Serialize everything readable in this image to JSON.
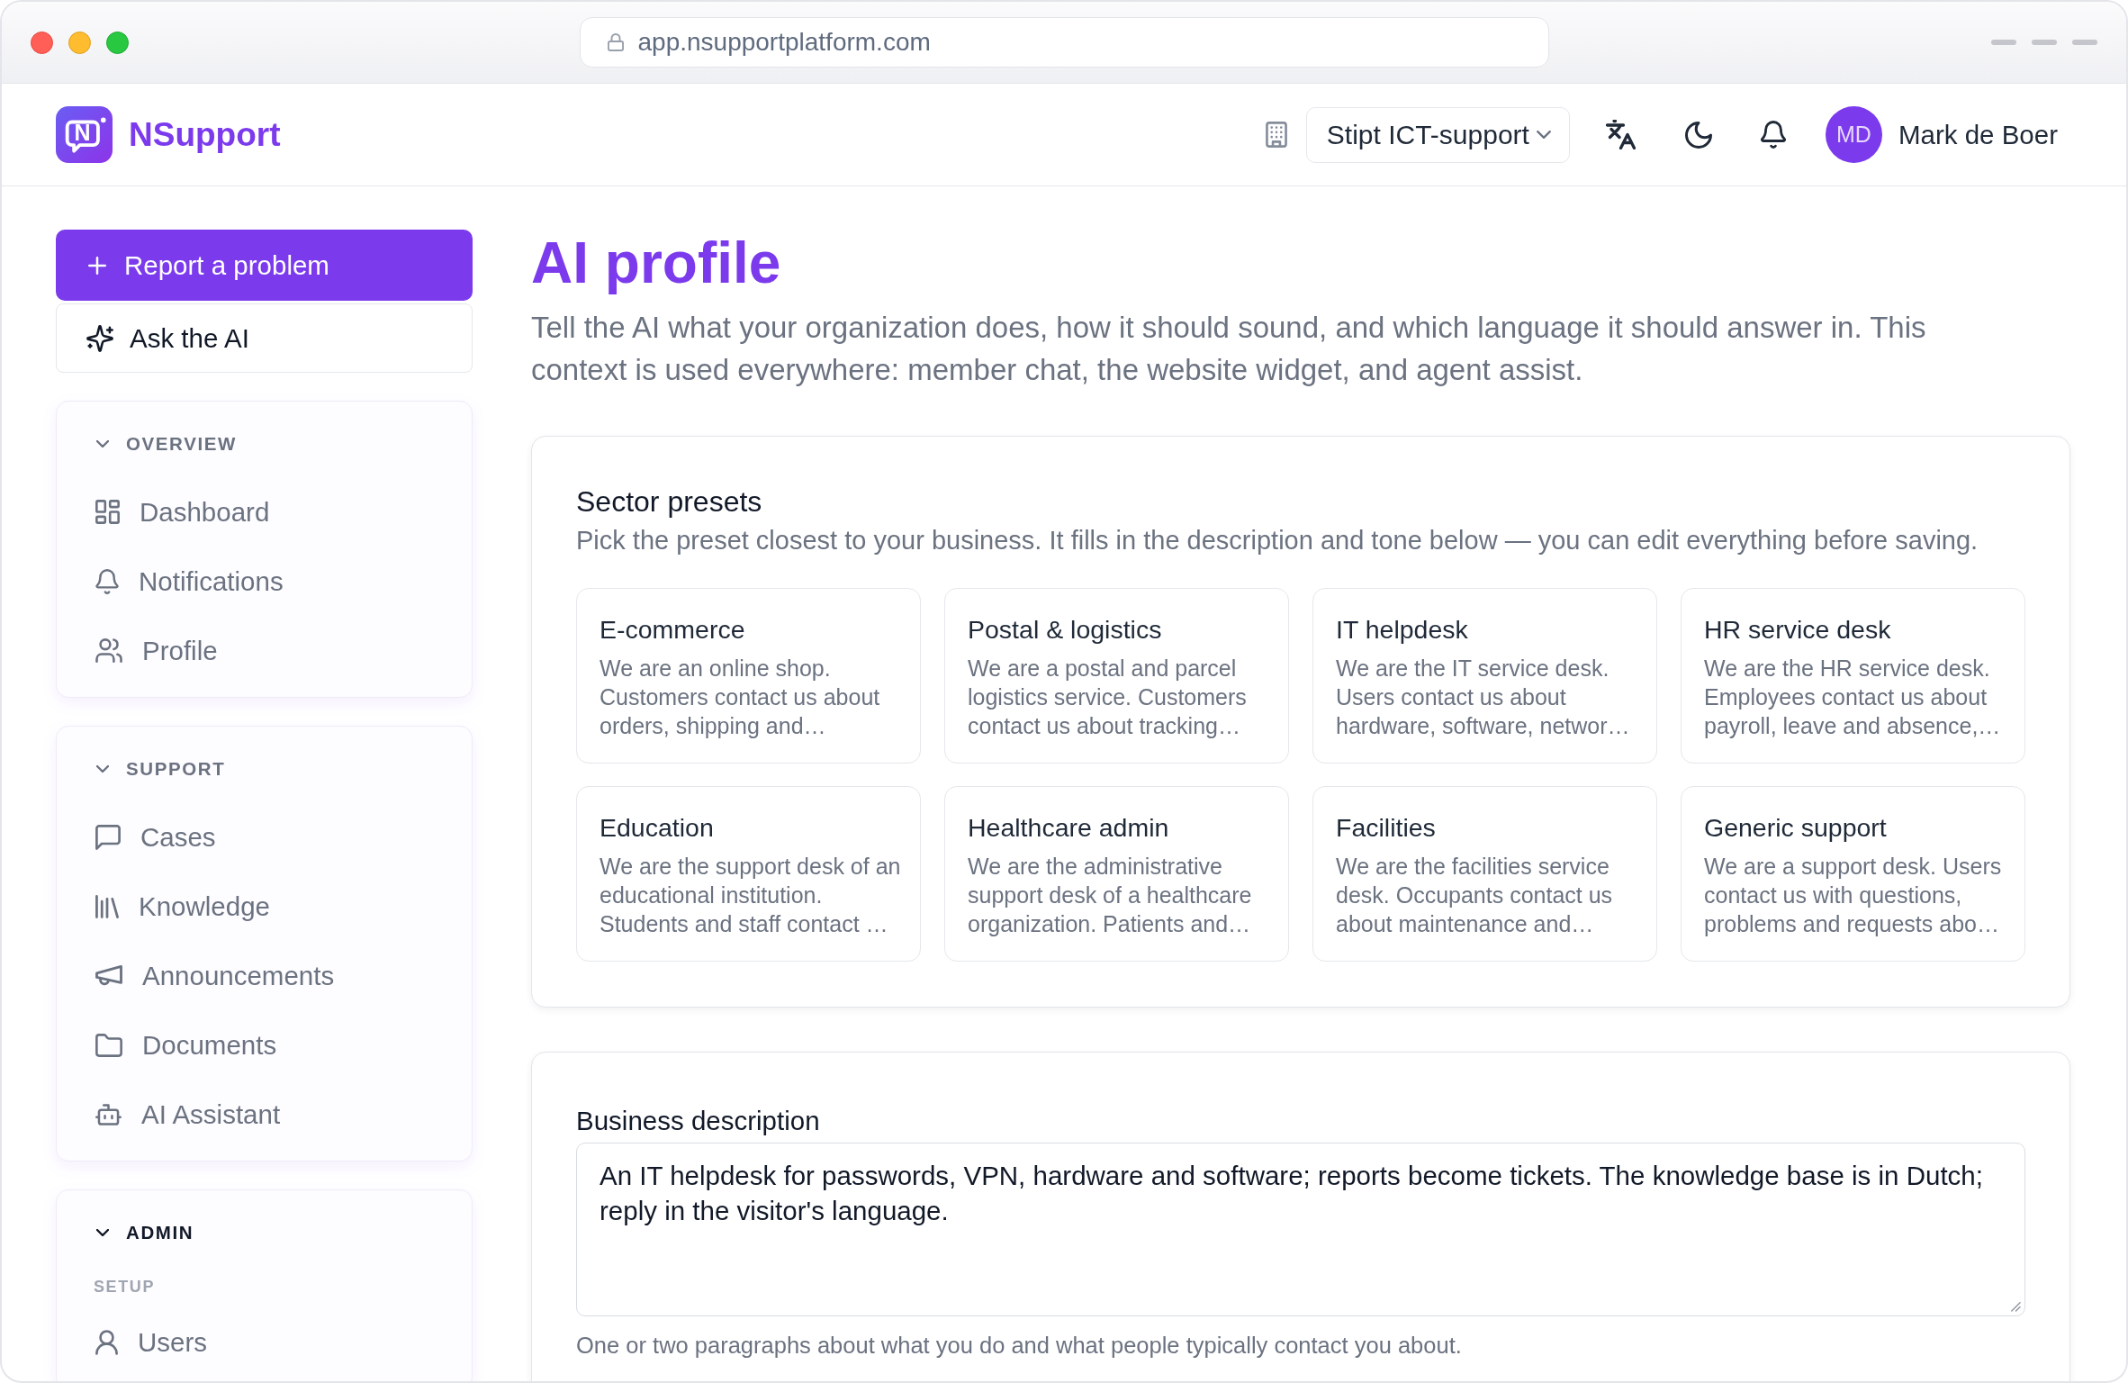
{
  "browser": {
    "url": "app.nsupportplatform.com"
  },
  "header": {
    "logo_letter": "N",
    "brand": "NSupport",
    "organization": "Stipt ICT-support",
    "user": {
      "initials": "MD",
      "name": "Mark de Boer"
    }
  },
  "sidebar": {
    "actions": [
      {
        "kind": "primary",
        "label": "Report a problem"
      },
      {
        "kind": "secondary",
        "label": "Ask the AI"
      }
    ],
    "sections": [
      {
        "title": "OVERVIEW",
        "expanded": true,
        "active": false,
        "items": [
          {
            "kind": "link",
            "label": "Dashboard"
          },
          {
            "kind": "link",
            "label": "Notifications"
          },
          {
            "kind": "link",
            "label": "Profile"
          }
        ]
      },
      {
        "title": "SUPPORT",
        "expanded": true,
        "active": false,
        "items": [
          {
            "kind": "link",
            "label": "Cases"
          },
          {
            "kind": "link",
            "label": "Knowledge"
          },
          {
            "kind": "link",
            "label": "Announcements"
          },
          {
            "kind": "link",
            "label": "Documents"
          },
          {
            "kind": "link",
            "label": "AI Assistant"
          }
        ]
      },
      {
        "title": "ADMIN",
        "expanded": true,
        "active": true,
        "items": [
          {
            "kind": "group",
            "label": "SETUP"
          },
          {
            "kind": "link",
            "label": "Users"
          }
        ]
      }
    ]
  },
  "page": {
    "title": "AI profile",
    "intro": "Tell the AI what your organization does, how it should sound, and which language it should answer in. This context is used everywhere: member chat, the website widget, and agent assist."
  },
  "presets": {
    "title": "Sector presets",
    "description": "Pick the preset closest to your business. It fills in the description and tone below — you can edit everything before saving.",
    "items": [
      {
        "name": "E-commerce",
        "description": "We are an online shop. Customers contact us about orders, shipping and…"
      },
      {
        "name": "Postal & logistics",
        "description": "We are a postal and parcel logistics service. Customers contact us about tracking…"
      },
      {
        "name": "IT helpdesk",
        "description": "We are the IT service desk. Users contact us about hardware, software, networ…"
      },
      {
        "name": "HR service desk",
        "description": "We are the HR service desk. Employees contact us about payroll, leave and absence,…"
      },
      {
        "name": "Education",
        "description": "We are the support desk of an educational institution. Students and staff contact …"
      },
      {
        "name": "Healthcare admin",
        "description": "We are the administrative support desk of a healthcare organization. Patients and…"
      },
      {
        "name": "Facilities",
        "description": "We are the facilities service desk. Occupants contact us about maintenance and…"
      },
      {
        "name": "Generic support",
        "description": "We are a support desk. Users contact us with questions, problems and requests abo…"
      }
    ]
  },
  "business_description": {
    "label": "Business description",
    "value": "An IT helpdesk for passwords, VPN, hardware and software; reports become tickets. The knowledge base is in Dutch; reply in the visitor's language.",
    "hint": "One or two paragraphs about what you do and what people typically contact you about."
  }
}
